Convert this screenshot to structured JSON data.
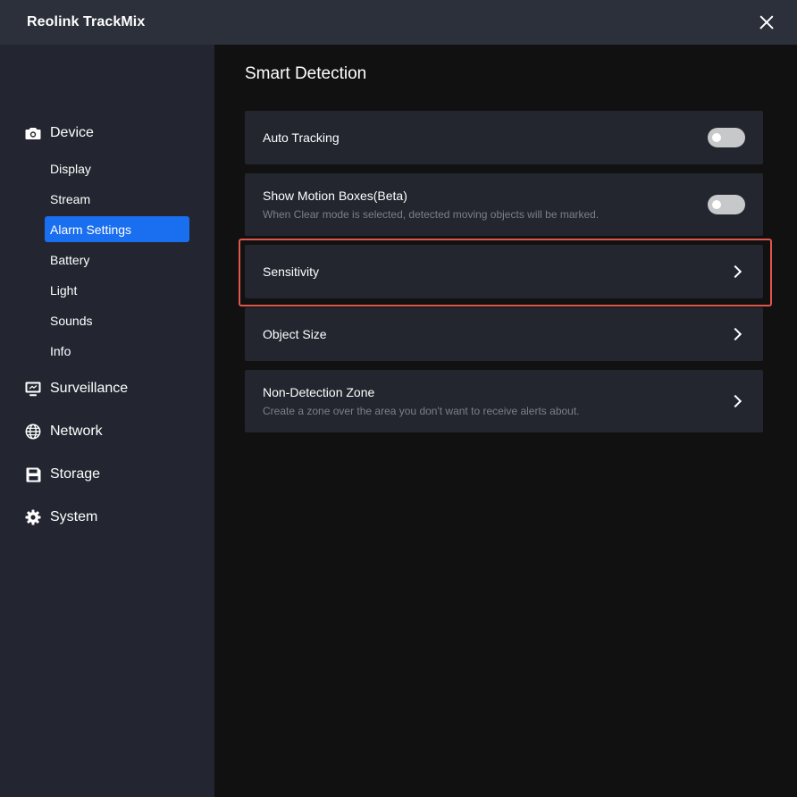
{
  "window": {
    "title": "Reolink TrackMix"
  },
  "sidebar": {
    "sections": [
      {
        "label": "Device",
        "icon": "camera-icon"
      },
      {
        "label": "Surveillance",
        "icon": "monitor-icon"
      },
      {
        "label": "Network",
        "icon": "globe-icon"
      },
      {
        "label": "Storage",
        "icon": "floppy-disk-icon"
      },
      {
        "label": "System",
        "icon": "gear-icon"
      }
    ],
    "device_items": [
      {
        "label": "Display"
      },
      {
        "label": "Stream"
      },
      {
        "label": "Alarm Settings",
        "active": true
      },
      {
        "label": "Battery"
      },
      {
        "label": "Light"
      },
      {
        "label": "Sounds"
      },
      {
        "label": "Info"
      }
    ]
  },
  "main": {
    "title": "Smart Detection",
    "rows": [
      {
        "label": "Auto Tracking",
        "control": "toggle",
        "enabled": false
      },
      {
        "label": "Show Motion Boxes(Beta)",
        "description": "When Clear mode is selected, detected moving objects will be marked.",
        "control": "toggle",
        "enabled": false
      },
      {
        "label": "Sensitivity",
        "control": "chevron",
        "highlighted": true
      },
      {
        "label": "Object Size",
        "control": "chevron"
      },
      {
        "label": "Non-Detection Zone",
        "description": "Create a zone over the area you don't want to receive alerts about.",
        "control": "chevron"
      }
    ]
  },
  "colors": {
    "accent": "#1a6ef0",
    "highlight_border": "#e0564b",
    "titlebar_bg": "#2b303b",
    "sidebar_bg": "#232630",
    "row_bg": "#23262f"
  }
}
